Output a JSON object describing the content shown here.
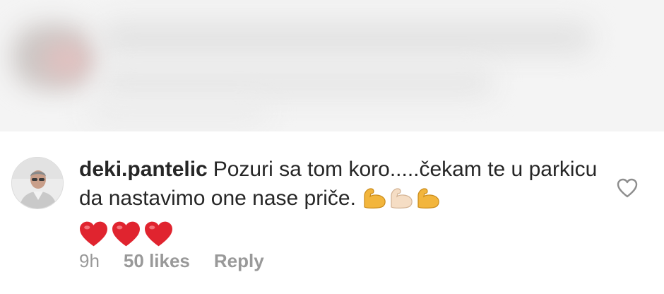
{
  "blurred_comment": {
    "icon": "blurred-content"
  },
  "comment": {
    "username": "deki.pantelic",
    "text": "Pozuri sa tom koro.....čekam te u parkicu da nastavimo one nase priče.",
    "emojis": [
      "flexed-biceps-medium",
      "flexed-biceps-light",
      "flexed-biceps-medium"
    ],
    "hearts": [
      "red-heart",
      "red-heart",
      "red-heart"
    ],
    "time": "9h",
    "likes": "50 likes",
    "reply_label": "Reply",
    "like_icon": "heart-outline-icon"
  },
  "colors": {
    "text": "#262626",
    "meta": "#999999",
    "heart": "#e0242f",
    "biceps_medium": "#f2b53c",
    "biceps_light": "#f5ddc4"
  }
}
